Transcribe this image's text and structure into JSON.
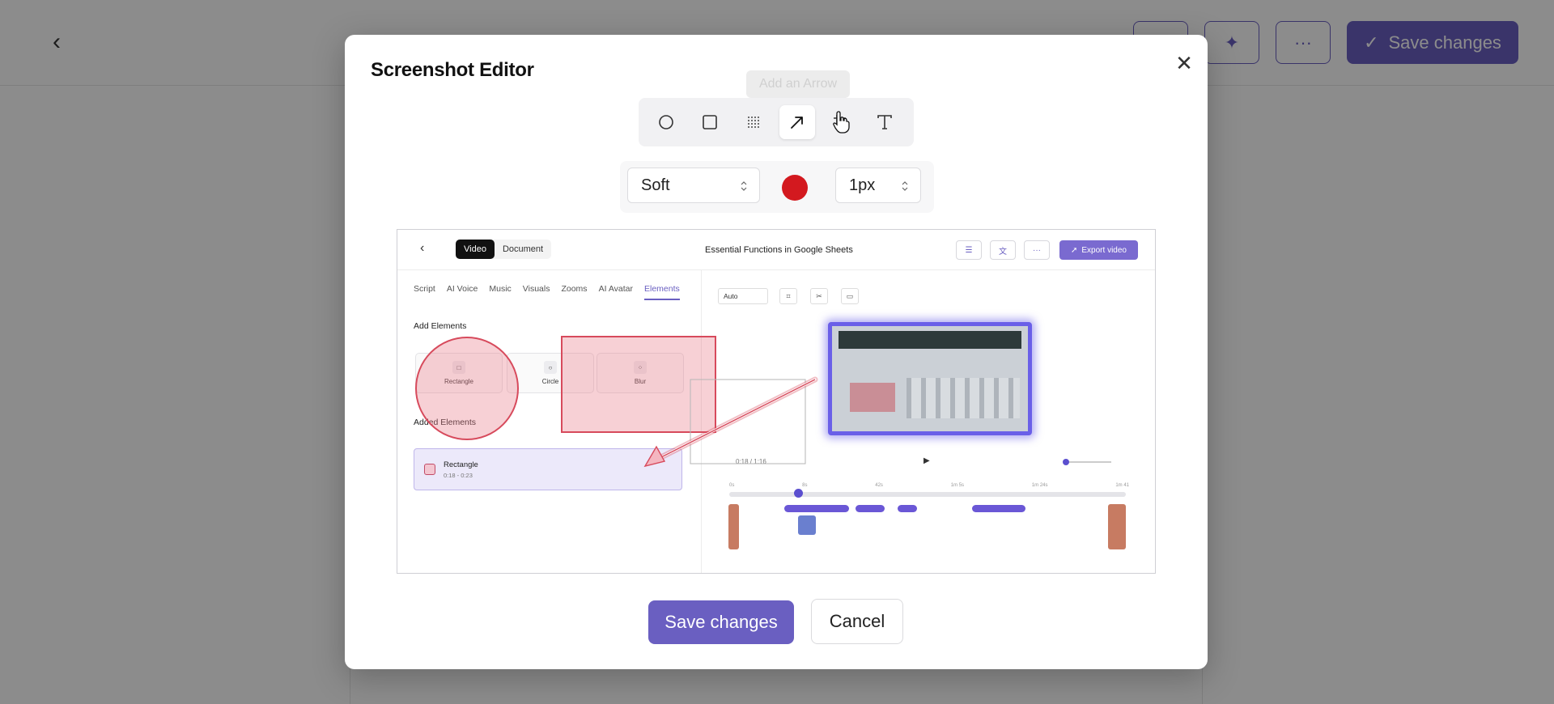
{
  "background": {
    "save_label": "Save changes"
  },
  "modal": {
    "title": "Screenshot Editor",
    "tooltip": "Add an Arrow",
    "tools": [
      "circle-tool",
      "rectangle-tool",
      "blur-tool",
      "arrow-tool",
      "crop-tool",
      "text-tool"
    ],
    "active_tool": "arrow-tool",
    "style_select": "Soft",
    "color": "#d3191f",
    "stroke_select": "1px",
    "save_label": "Save changes",
    "cancel_label": "Cancel"
  },
  "preview": {
    "tabs": [
      "Video",
      "Document"
    ],
    "title": "Essential Functions in Google Sheets",
    "export_label": "Export video",
    "nav_tabs": [
      "Script",
      "AI Voice",
      "Music",
      "Visuals",
      "Zooms",
      "AI Avatar",
      "Elements"
    ],
    "add_elements": "Add Elements",
    "cards": [
      "Rectangle",
      "Circle",
      "Blur"
    ],
    "added_elements": "Added Elements",
    "added_item_name": "Rectangle",
    "added_item_time": "0:18 - 0:23",
    "auto_label": "Auto",
    "time": "0:18 / 1:16",
    "ruler": [
      "0s",
      "8s",
      "42s",
      "1m 5s",
      "1m 24s",
      "1m 41"
    ]
  }
}
